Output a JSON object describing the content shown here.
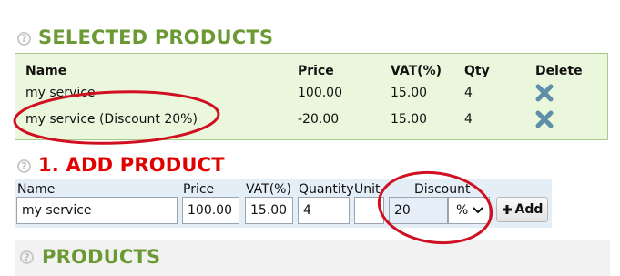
{
  "selected_section": {
    "title": "SELECTED PRODUCTS",
    "help_icon_label": "?",
    "columns": {
      "name": "Name",
      "price": "Price",
      "vat": "VAT(%)",
      "qty": "Qty",
      "delete": "Delete"
    },
    "rows": [
      {
        "name": "my service",
        "price": "100.00",
        "vat": "15.00",
        "qty": "4"
      },
      {
        "name": "my service (Discount 20%)",
        "price": "-20.00",
        "vat": "15.00",
        "qty": "4"
      }
    ]
  },
  "add_section": {
    "title": "1. ADD PRODUCT",
    "help_icon_label": "?",
    "labels": {
      "name": "Name",
      "price": "Price",
      "vat": "VAT(%)",
      "quantity": "Quantity",
      "unit": "Unit",
      "discount": "Discount"
    },
    "values": {
      "name": "my service",
      "price": "100.00",
      "vat": "15.00",
      "quantity": "4",
      "unit": "",
      "discount": "20"
    },
    "discount_unit": "%",
    "add_label": "Add"
  },
  "products_section": {
    "title": "PRODUCTS",
    "help_icon_label": "?"
  },
  "colors": {
    "section_green": "#6b9a34",
    "section_red": "#e00000",
    "annotation_red": "#d01020",
    "delete_icon": "#5f8ea8"
  },
  "icons": [
    "help-icon",
    "delete-x-icon",
    "chevron-down-icon",
    "plus-icon"
  ]
}
